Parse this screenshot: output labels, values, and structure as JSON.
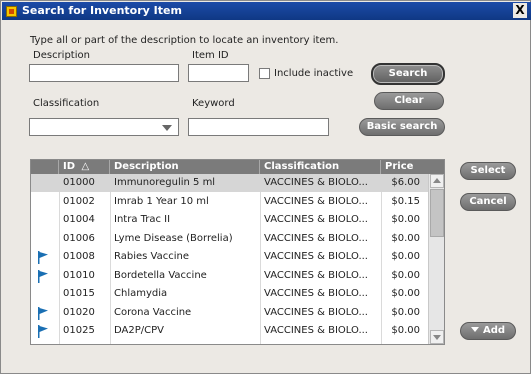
{
  "window": {
    "title": "Search for Inventory Item",
    "close_label": "X"
  },
  "instructions": "Type all or part of the description to locate an inventory item.",
  "form": {
    "description_label": "Description",
    "description_value": "",
    "item_id_label": "Item ID",
    "item_id_value": "",
    "include_inactive_label": "Include inactive",
    "include_inactive_checked": false,
    "classification_label": "Classification",
    "classification_value": "",
    "keyword_label": "Keyword",
    "keyword_value": ""
  },
  "buttons": {
    "search": "Search",
    "clear": "Clear",
    "basic_search": "Basic search",
    "select": "Select",
    "cancel": "Cancel",
    "add": "Add"
  },
  "table": {
    "columns": [
      "",
      "ID",
      "Description",
      "Classification",
      "Price"
    ],
    "sort_indicator": "△",
    "rows": [
      {
        "flag": false,
        "id": "01000",
        "description": "Immunoregulin 5 ml",
        "classification": "VACCINES & BIOLO...",
        "price": "$6.00",
        "selected": true
      },
      {
        "flag": false,
        "id": "01002",
        "description": "Imrab 1 Year 10 ml",
        "classification": "VACCINES & BIOLO...",
        "price": "$0.15"
      },
      {
        "flag": false,
        "id": "01004",
        "description": "Intra Trac II",
        "classification": "VACCINES & BIOLO...",
        "price": "$0.00"
      },
      {
        "flag": false,
        "id": "01006",
        "description": "Lyme Disease (Borrelia)",
        "classification": "VACCINES & BIOLO...",
        "price": "$0.00"
      },
      {
        "flag": true,
        "id": "01008",
        "description": "Rabies Vaccine",
        "classification": "VACCINES & BIOLO...",
        "price": "$0.00"
      },
      {
        "flag": true,
        "id": "01010",
        "description": "Bordetella Vaccine",
        "classification": "VACCINES & BIOLO...",
        "price": "$0.00"
      },
      {
        "flag": false,
        "id": "01015",
        "description": "Chlamydia",
        "classification": "VACCINES & BIOLO...",
        "price": "$0.00"
      },
      {
        "flag": true,
        "id": "01020",
        "description": "Corona Vaccine",
        "classification": "VACCINES & BIOLO...",
        "price": "$0.00"
      },
      {
        "flag": true,
        "id": "01025",
        "description": "DA2P/CPV",
        "classification": "VACCINES & BIOLO...",
        "price": "$0.00"
      }
    ]
  },
  "colors": {
    "title_bar": "#103a8c",
    "flag": "#1a6fb3",
    "header": "#7b7b7b",
    "selected_row": "#d6d6d6"
  },
  "icons": {
    "flag": "flag-icon",
    "dropdown": "chevron-down-icon",
    "app": "app-icon",
    "close": "close-icon"
  }
}
